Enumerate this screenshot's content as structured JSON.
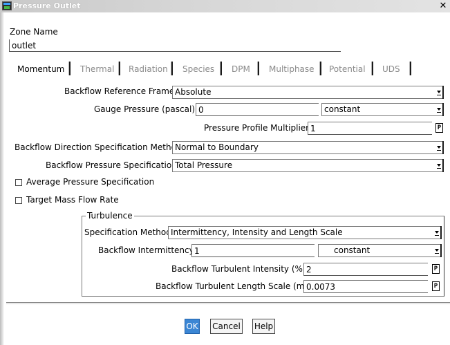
{
  "window": {
    "title": "Pressure Outlet",
    "close_symbol": "✕"
  },
  "zone": {
    "label": "Zone Name",
    "value": "outlet"
  },
  "tabs": [
    {
      "label": "Momentum",
      "active": true
    },
    {
      "label": "Thermal",
      "active": false
    },
    {
      "label": "Radiation",
      "active": false
    },
    {
      "label": "Species",
      "active": false
    },
    {
      "label": "DPM",
      "active": false
    },
    {
      "label": "Multiphase",
      "active": false
    },
    {
      "label": "Potential",
      "active": false
    },
    {
      "label": "UDS",
      "active": false
    }
  ],
  "momentum": {
    "backflow_reference_frame": {
      "label": "Backflow Reference Frame",
      "value": "Absolute"
    },
    "gauge_pressure": {
      "label": "Gauge Pressure (pascal)",
      "value": "0",
      "method": "constant"
    },
    "pressure_profile_multiplier": {
      "label": "Pressure Profile Multiplier",
      "value": "1",
      "param_button": "P"
    },
    "backflow_direction": {
      "label": "Backflow Direction Specification Method",
      "value": "Normal to Boundary"
    },
    "backflow_pressure_spec": {
      "label": "Backflow Pressure Specification",
      "value": "Total Pressure"
    },
    "average_pressure_spec": {
      "label": "Average Pressure Specification",
      "checked": false
    },
    "target_mass_flow_rate": {
      "label": "Target Mass Flow Rate",
      "checked": false
    }
  },
  "turbulence": {
    "group_label": "Turbulence",
    "specification_method": {
      "label": "Specification Method",
      "value": "Intermittency, Intensity and Length Scale"
    },
    "backflow_intermittency": {
      "label": "Backflow Intermittency",
      "value": "1",
      "method": "constant"
    },
    "backflow_turbulent_intensity": {
      "label": "Backflow Turbulent Intensity (%)",
      "value": "2",
      "param_button": "P"
    },
    "backflow_turbulent_length_scale": {
      "label": "Backflow Turbulent Length Scale (m)",
      "value": "0.0073",
      "param_button": "P"
    }
  },
  "buttons": {
    "ok": "OK",
    "cancel": "Cancel",
    "help": "Help"
  },
  "colors": {
    "ok_button": "#3b86d4",
    "titlebar": "#d6d6d6"
  }
}
